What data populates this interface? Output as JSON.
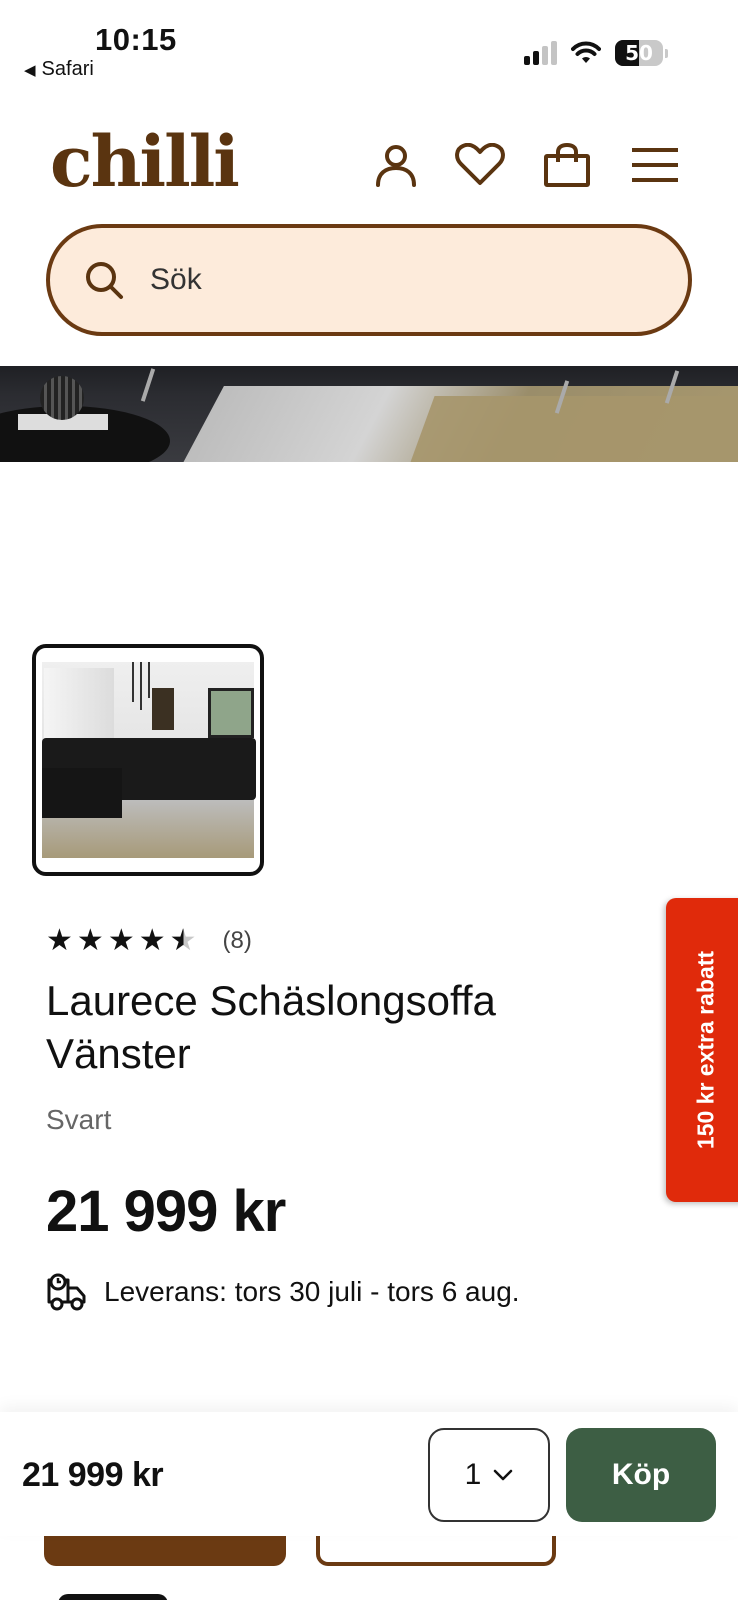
{
  "status_bar": {
    "time": "10:15",
    "back_app": "Safari",
    "battery": "50"
  },
  "header": {
    "logo": "chilli",
    "icons": [
      "account-icon",
      "heart-icon",
      "bag-icon",
      "menu-icon"
    ],
    "brand_color": "#5a3410"
  },
  "search": {
    "placeholder": "Sök",
    "background": "#fdebdb",
    "border": "#6b3a12"
  },
  "product": {
    "rating": 4.5,
    "rating_max": 5,
    "review_count": "(8)",
    "title": "Laurece Schäslongsoffa Vänster",
    "color": "Svart",
    "price": "21 999 kr",
    "delivery": "Leverans: tors 30 juli - tors 6 aug."
  },
  "promo_tab": {
    "label": "150 kr extra rabatt",
    "color": "#e02a0b"
  },
  "bottom_bar": {
    "price": "21 999 kr",
    "quantity": "1",
    "buy_label": "Köp",
    "buy_color": "#3d5e44"
  }
}
